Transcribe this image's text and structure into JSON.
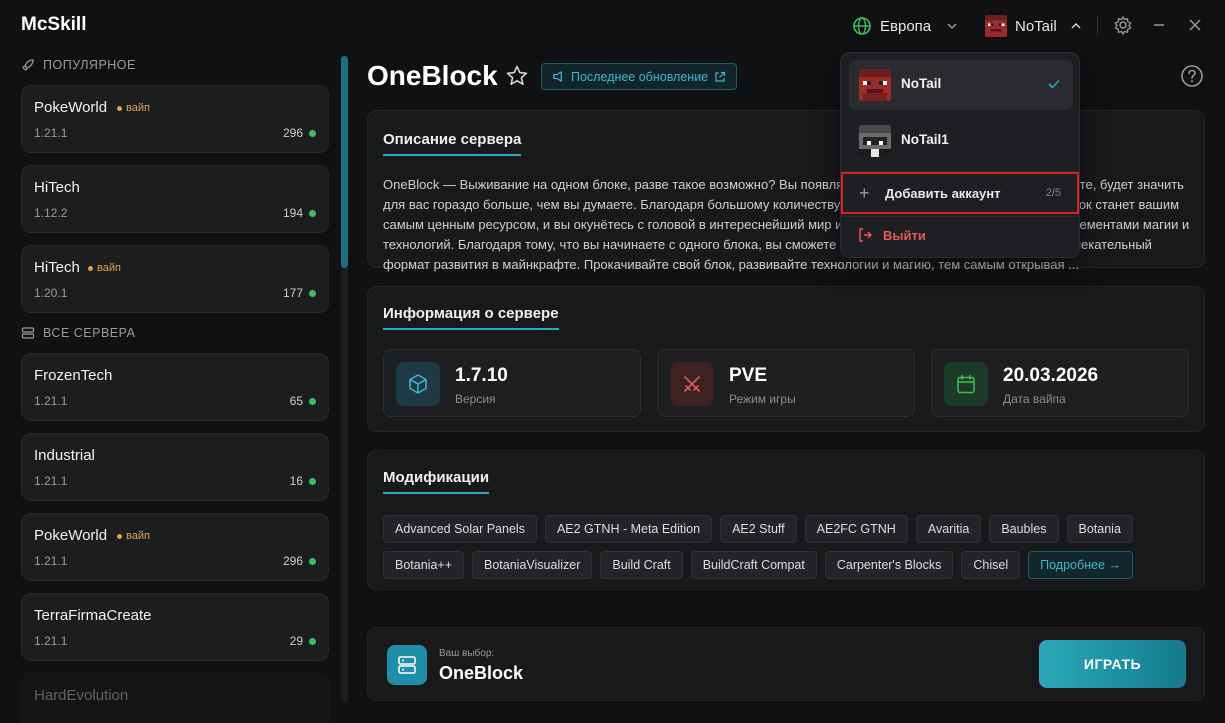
{
  "app": {
    "title": "McSkill"
  },
  "header": {
    "region": "Европа",
    "account": "NoTail"
  },
  "sidebar": {
    "popular_label": "ПОПУЛЯРНОЕ",
    "all_label": "ВСЕ СЕРВЕРА",
    "wipe_label": "вайп",
    "popular": [
      {
        "name": "PokeWorld",
        "version": "1.21.1",
        "online": "296",
        "wipe": true
      },
      {
        "name": "HiTech",
        "version": "1.12.2",
        "online": "194",
        "wipe": false
      },
      {
        "name": "HiTech",
        "version": "1.20.1",
        "online": "177",
        "wipe": true
      }
    ],
    "all": [
      {
        "name": "FrozenTech",
        "version": "1.21.1",
        "online": "65",
        "wipe": false
      },
      {
        "name": "Industrial",
        "version": "1.21.1",
        "online": "16",
        "wipe": false
      },
      {
        "name": "PokeWorld",
        "version": "1.21.1",
        "online": "296",
        "wipe": true
      },
      {
        "name": "TerraFirmaCreate",
        "version": "1.21.1",
        "online": "29",
        "wipe": false
      },
      {
        "name": "HardEvolution",
        "version": "",
        "online": "",
        "wipe": false
      }
    ]
  },
  "main": {
    "title": "OneBlock",
    "update_label": "Последнее обновление",
    "description": {
      "title": "Описание сервера",
      "text": "OneBlock  — Выживание на одном блоке, разве такое возможно? Вы появляетесь на одном блоке, который, поверьте, будет значить для вас гораздо больше, чем вы думаете. Благодаря большому количеству модов, локаций и квестов этот один блок станет вашим самым ценным ресурсом, и вы окунётесь с головой в интереснейший мир индустриализации с увлекательными элементами магии и технологий. Благодаря тому, что вы начинаете с одного блока, вы сможете открыть для себя поистине новый и увлекательный формат развития в майнкрафте. Прокачивайте свой блок, развивайте технологии и магию, тем самым открывая ..."
    },
    "info": {
      "title": "Информация о сервере",
      "cards": [
        {
          "value": "1.7.10",
          "label": "Версия"
        },
        {
          "value": "PVE",
          "label": "Режим игры"
        },
        {
          "value": "20.03.2026",
          "label": "Дата вайпа"
        }
      ]
    },
    "mods": {
      "title": "Модификации",
      "items": [
        "Advanced Solar Panels",
        "AE2 GTNH - Meta Edition",
        "AE2 Stuff",
        "AE2FC GTNH",
        "Avaritia",
        "Baubles",
        "Botania",
        "Botania++",
        "BotaniaVisualizer",
        "Build Craft",
        "BuildCraft Compat",
        "Carpenter's Blocks",
        "Chisel"
      ],
      "more": "Подробнее →"
    },
    "selection": {
      "label": "Ваш выбор:",
      "name": "OneBlock",
      "play": "ИГРАТЬ"
    }
  },
  "dropdown": {
    "accounts": [
      "NoTail",
      "NoTail1"
    ],
    "add_label": "Добавить аккаунт",
    "add_count": "2/5",
    "logout": "Выйти"
  },
  "colors": {
    "accent": "#2aa8c4",
    "online": "#3fbf5c",
    "wipe": "#e0a346",
    "danger": "#e25a5a",
    "highlight": "#e01e26"
  }
}
